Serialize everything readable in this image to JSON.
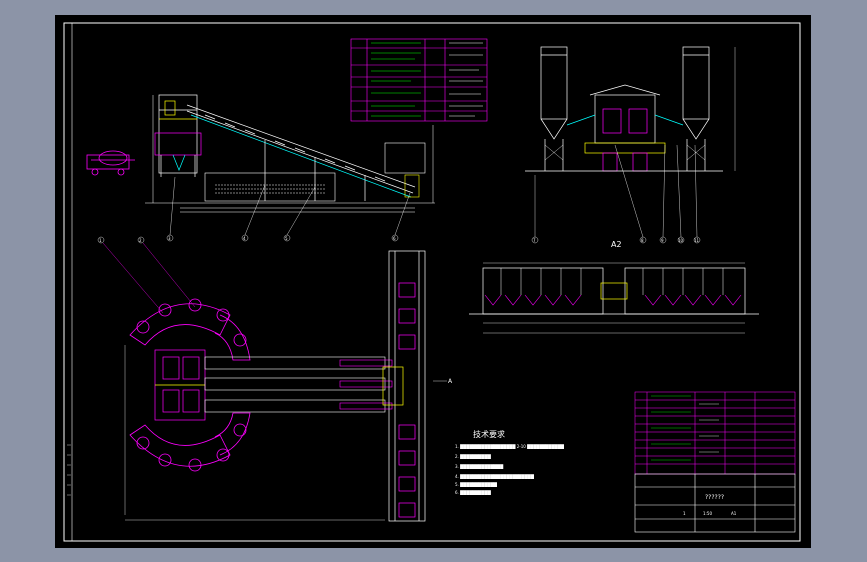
{
  "views": {
    "a2_label": "A2",
    "section_label": "A"
  },
  "tech_requirements": {
    "title": "技术要求",
    "items": [
      "1. ██████████████████ 2-10 ████████████",
      "2. ██████████",
      "3. ██████████████",
      "4. ████████████████████████",
      "5. ████████████",
      "6. ██████████"
    ]
  },
  "title_block": {
    "drawing_name": "??????",
    "scale": "1:50",
    "sheet": "A1",
    "qty": "1"
  },
  "colors": {
    "frame": "#ffffff",
    "outline": "#00ffff",
    "detail": "#ff00ff",
    "cable": "#00ff00",
    "mixer": "#ffff00",
    "table": "#ff00ff"
  },
  "callouts": [
    "1",
    "2",
    "3",
    "4",
    "5",
    "6",
    "7",
    "8",
    "9",
    "10",
    "11",
    "12"
  ]
}
